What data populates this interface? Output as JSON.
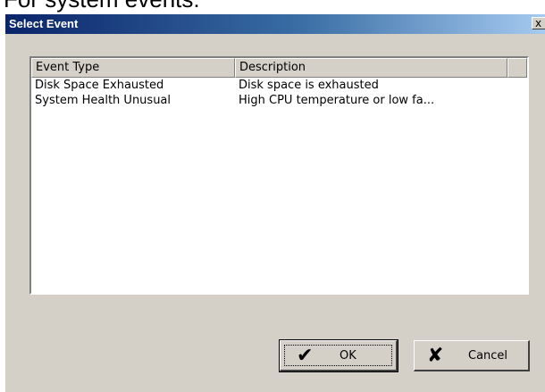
{
  "document": {
    "caption": "For system events:"
  },
  "dialog": {
    "title": "Select Event",
    "close_glyph": "x",
    "list": {
      "columns": [
        "Event Type",
        "Description"
      ],
      "rows": [
        {
          "event_type": "Disk Space Exhausted",
          "description": "Disk space is exhausted"
        },
        {
          "event_type": "System Health Unusual",
          "description": "High CPU temperature or low fa..."
        }
      ]
    },
    "buttons": {
      "ok_label": "OK",
      "ok_icon": "checkmark-icon",
      "cancel_label": "Cancel",
      "cancel_icon": "cross-icon"
    }
  }
}
